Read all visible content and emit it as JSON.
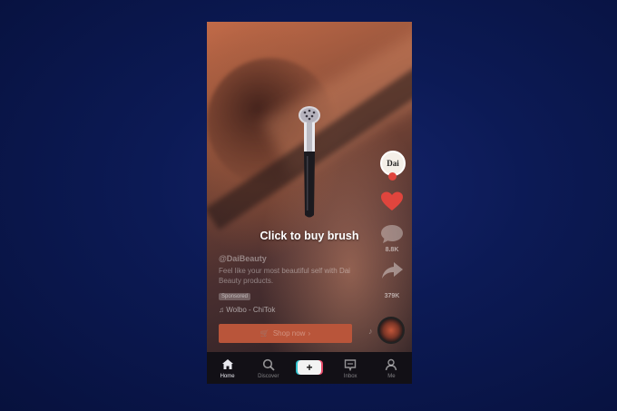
{
  "video": {
    "caption": "Click to buy brush"
  },
  "rail": {
    "avatar_text": "Dai",
    "comment_count": "8.8K",
    "share_count": "379K"
  },
  "meta": {
    "handle": "@DaiBeauty",
    "description": "Feel like your most beautiful self with Dai Beauty products.",
    "sponsored": "Sponsored",
    "music": "Wolbo - ChiTok"
  },
  "shop": {
    "label": "Shop now"
  },
  "nav": {
    "items": [
      {
        "label": "Home",
        "icon": "home-icon"
      },
      {
        "label": "Discover",
        "icon": "search-icon"
      },
      {
        "label": "",
        "icon": "plus-icon"
      },
      {
        "label": "Inbox",
        "icon": "inbox-icon"
      },
      {
        "label": "Me",
        "icon": "profile-icon"
      }
    ]
  },
  "colors": {
    "background": "#0c1a55",
    "shop_button": "#b9553a",
    "like_heart": "#e0453d"
  }
}
